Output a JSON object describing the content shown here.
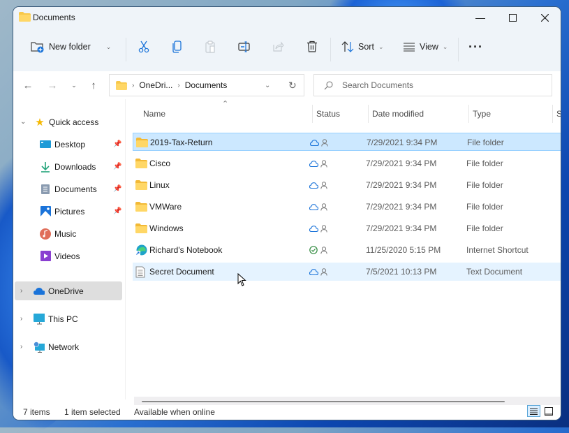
{
  "window": {
    "title": "Documents",
    "controls": {
      "minimize": "minimize-icon",
      "maximize": "maximize-icon",
      "close": "close-icon"
    }
  },
  "toolbar": {
    "new_folder_label": "New folder",
    "sort_label": "Sort",
    "view_label": "View",
    "icons": [
      "new-folder-icon",
      "cut-icon",
      "copy-icon",
      "paste-icon",
      "rename-icon",
      "share-icon",
      "delete-icon",
      "sort-icon",
      "view-icon",
      "more-icon"
    ]
  },
  "nav": {
    "breadcrumb": [
      "OneDri...",
      "Documents"
    ],
    "search_placeholder": "Search Documents"
  },
  "sidebar": {
    "quick_access": "Quick access",
    "items": [
      {
        "label": "Desktop",
        "icon": "desktop-icon",
        "pinned": true
      },
      {
        "label": "Downloads",
        "icon": "downloads-icon",
        "pinned": true
      },
      {
        "label": "Documents",
        "icon": "documents-icon",
        "pinned": true
      },
      {
        "label": "Pictures",
        "icon": "pictures-icon",
        "pinned": true
      },
      {
        "label": "Music",
        "icon": "music-icon",
        "pinned": false
      },
      {
        "label": "Videos",
        "icon": "videos-icon",
        "pinned": false
      }
    ],
    "roots": [
      {
        "label": "OneDrive",
        "icon": "onedrive-icon",
        "selected": true
      },
      {
        "label": "This PC",
        "icon": "this-pc-icon",
        "selected": false
      },
      {
        "label": "Network",
        "icon": "network-icon",
        "selected": false
      }
    ]
  },
  "columns": [
    "Name",
    "Status",
    "Date modified",
    "Type",
    "S"
  ],
  "files": [
    {
      "name": "2019-Tax-Return",
      "status": "cloud",
      "date": "7/29/2021 9:34 PM",
      "type": "File folder",
      "kind": "folder",
      "state": "selected"
    },
    {
      "name": "Cisco",
      "status": "cloud",
      "date": "7/29/2021 9:34 PM",
      "type": "File folder",
      "kind": "folder",
      "state": ""
    },
    {
      "name": "Linux",
      "status": "cloud",
      "date": "7/29/2021 9:34 PM",
      "type": "File folder",
      "kind": "folder",
      "state": ""
    },
    {
      "name": "VMWare",
      "status": "cloud",
      "date": "7/29/2021 9:34 PM",
      "type": "File folder",
      "kind": "folder",
      "state": ""
    },
    {
      "name": "Windows",
      "status": "cloud",
      "date": "7/29/2021 9:34 PM",
      "type": "File folder",
      "kind": "folder",
      "state": ""
    },
    {
      "name": "Richard's Notebook",
      "status": "synced",
      "date": "11/25/2020 5:15 PM",
      "type": "Internet Shortcut",
      "kind": "shortcut",
      "state": ""
    },
    {
      "name": "Secret Document",
      "status": "cloud",
      "date": "7/5/2021 10:13 PM",
      "type": "Text Document",
      "kind": "text",
      "state": "hover"
    }
  ],
  "status": {
    "item_count": "7 items",
    "selected": "1 item selected",
    "availability": "Available when online"
  },
  "colors": {
    "accent": "#0067c0",
    "selection": "#cce8ff",
    "folder": "#f8c84a",
    "synced": "#2f8a3e"
  }
}
